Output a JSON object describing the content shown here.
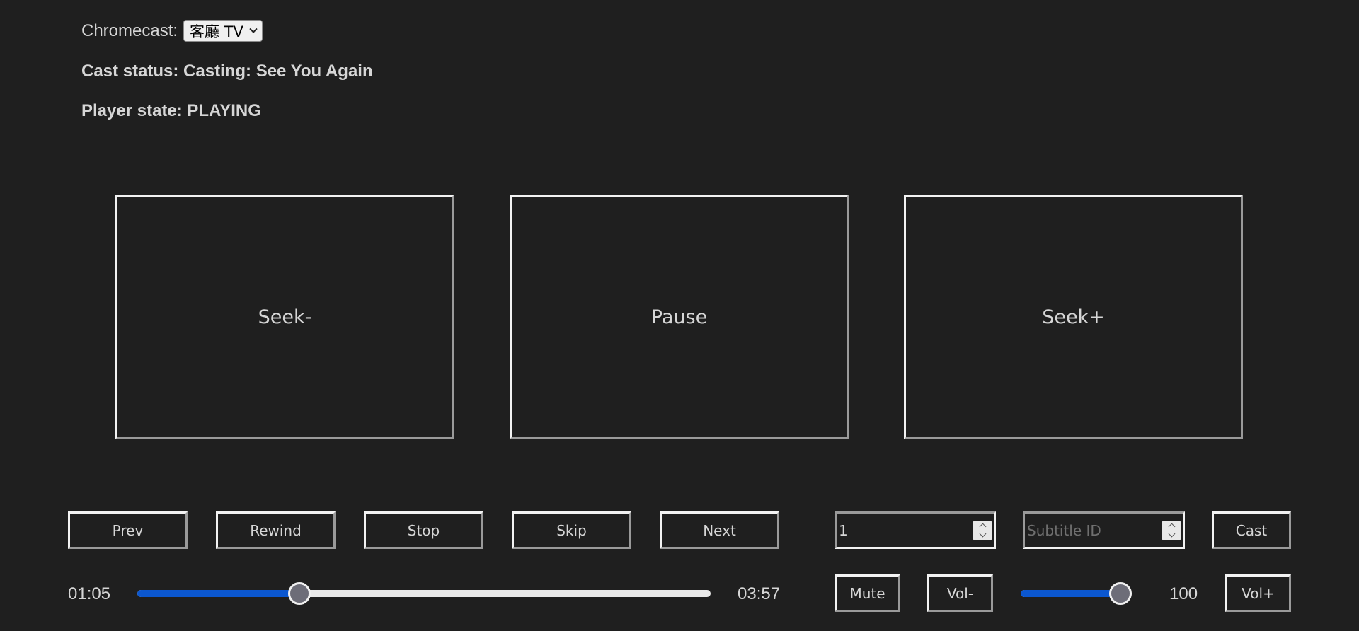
{
  "chromecast": {
    "label": "Chromecast:",
    "selected_device": "客廳 TV"
  },
  "cast_status": "Cast status: Casting: See You Again",
  "player_state": "Player state: PLAYING",
  "big_controls": {
    "seek_back": "Seek-",
    "pause": "Pause",
    "seek_forward": "Seek+"
  },
  "transport": {
    "prev": "Prev",
    "rewind": "Rewind",
    "stop": "Stop",
    "skip": "Skip",
    "next": "Next"
  },
  "inputs": {
    "track_value": "1",
    "subtitle_placeholder": "Subtitle ID"
  },
  "cast_button": "Cast",
  "progress": {
    "current": "01:05",
    "total": "03:57",
    "fraction": 0.2743
  },
  "volume": {
    "mute": "Mute",
    "down": "Vol-",
    "up": "Vol+",
    "value": "100",
    "fraction": 1.0
  },
  "colors": {
    "background": "#1f1f1f",
    "accent": "#0b57d0",
    "text": "#d6d6d6"
  }
}
